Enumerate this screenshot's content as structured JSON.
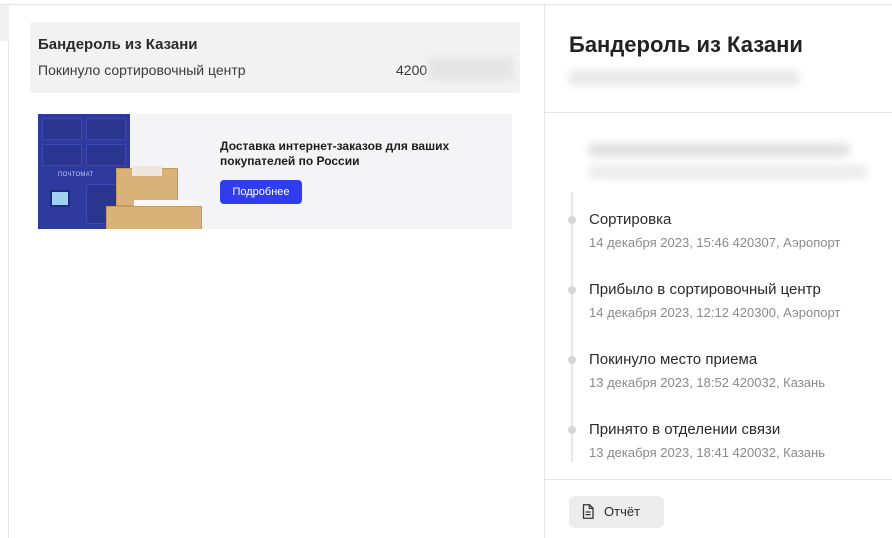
{
  "shipment": {
    "title": "Бандероль из Казани",
    "status": "Покинуло сортировочный центр",
    "track_prefix": "4200"
  },
  "banner": {
    "headline": "Доставка интернет-заказов для ваших покупателей по России",
    "button": "Подробнее",
    "locker_brand": "ПОЧТОМАТ",
    "accent": "#2f3cf0"
  },
  "panel": {
    "title": "Бандероль из Казани",
    "events": [
      {
        "name": "Сортировка",
        "meta": "14 декабря 2023, 15:46 420307, Аэропорт"
      },
      {
        "name": "Прибыло в сортировочный центр",
        "meta": "14 декабря 2023, 12:12 420300, Аэропорт"
      },
      {
        "name": "Покинуло место приема",
        "meta": "13 декабря 2023, 18:52 420032, Казань"
      },
      {
        "name": "Принято в отделении связи",
        "meta": "13 декабря 2023, 18:41 420032, Казань"
      }
    ],
    "report_button": {
      "label": "Отчёт",
      "icon": "document-icon"
    }
  }
}
